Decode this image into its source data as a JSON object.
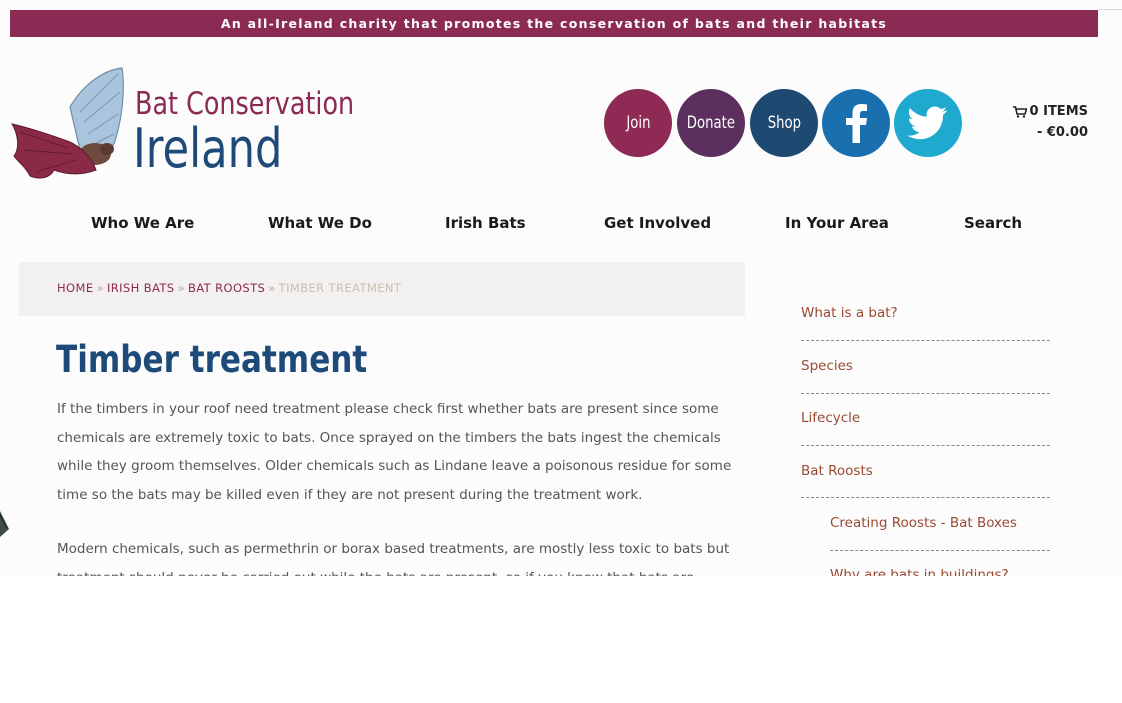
{
  "topbar": {
    "tagline": "An all-Ireland charity that promotes the conservation of bats and their habitats"
  },
  "logo": {
    "line1": "Bat Conservation",
    "line2": "Ireland"
  },
  "actions": {
    "join": "Join",
    "donate": "Donate",
    "shop": "Shop",
    "facebook_icon": "facebook-icon",
    "twitter_icon": "twitter-icon"
  },
  "cart": {
    "items": "0 ITEMS",
    "total": "- €0.00",
    "icon": "cart-icon"
  },
  "nav": {
    "items": [
      "Who We Are",
      "What We Do",
      "Irish Bats",
      "Get Involved",
      "In Your Area",
      "Search"
    ]
  },
  "breadcrumb": {
    "home": "HOME",
    "irish_bats": "IRISH BATS",
    "bat_roosts": "BAT ROOSTS",
    "current": "TIMBER TREATMENT",
    "separator": "»"
  },
  "page": {
    "title": "Timber treatment",
    "paragraph1_lines": [
      "If the timbers in your roof need treatment please check first whether bats are present since some",
      "chemicals are extremely toxic to bats. Once sprayed on the timbers the bats ingest the chemicals",
      "while they groom themselves. Older chemicals such as Lindane leave a poisonous residue for some",
      "time so the bats may be killed even if they are not present during the treatment work."
    ],
    "paragraph2_lines": [
      "Modern chemicals, such as permethrin or borax based treatments, are mostly less toxic to bats but",
      "treatment should never be carried out while the bats are present, so if you know that bats are"
    ]
  },
  "sidebar": {
    "items": [
      "What is a bat?",
      "Species",
      "Lifecycle",
      "Bat Roosts",
      "Creating Roosts - Bat Boxes",
      "Why are bats in buildings?"
    ]
  },
  "colors": {
    "brand_maroon": "#8b2a52",
    "brand_blue": "#1d4a78",
    "join": "#8f2a55",
    "donate": "#5b2f5e",
    "shop": "#1e4a72",
    "facebook": "#1a6fae",
    "twitter": "#1fa9cf",
    "sidebar_link": "#9a4a32"
  }
}
